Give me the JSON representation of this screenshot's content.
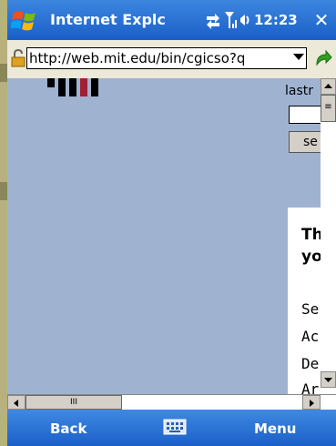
{
  "titlebar": {
    "title": "Internet Explc",
    "time": "12:23",
    "close_label": "✕"
  },
  "address": {
    "url": "http://web.mit.edu/bin/cgicso?q"
  },
  "page": {
    "lastname_label": "lastr",
    "search_button": "se",
    "panel_heading_1": "Th",
    "panel_heading_2": "yo",
    "panel_lines": [
      "Se",
      "Ac",
      "De",
      "Ar"
    ]
  },
  "softkeys": {
    "left": "Back",
    "right": "Menu"
  },
  "colors": {
    "titlebar": "#2a72d6",
    "content_bg": "#9fb3d1",
    "mit_red": "#a31f34"
  },
  "icons": [
    "windows-logo-icon",
    "connectivity-icon",
    "signal-icon",
    "volume-icon",
    "close-icon",
    "lock-icon",
    "dropdown-arrow-icon",
    "go-arrow-icon",
    "keyboard-icon"
  ]
}
